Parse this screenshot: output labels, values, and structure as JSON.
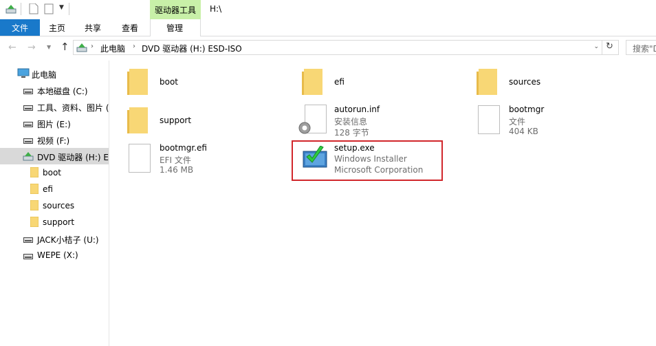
{
  "titlebar": {
    "context_tab": "驱动器工具",
    "window_title": "H:\\"
  },
  "ribbon": {
    "tabs": [
      "文件",
      "主页",
      "共享",
      "查看",
      "管理"
    ]
  },
  "address": {
    "breadcrumb": [
      "此电脑",
      "DVD 驱动器 (H:) ESD-ISO"
    ],
    "search_placeholder": "搜索\"D"
  },
  "nav": {
    "items": [
      {
        "label": "此电脑",
        "icon": "computer-icon"
      },
      {
        "label": "本地磁盘 (C:)",
        "icon": "drive-icon"
      },
      {
        "label": "工具、资料、图片 (",
        "icon": "drive-icon"
      },
      {
        "label": "图片 (E:)",
        "icon": "drive-icon"
      },
      {
        "label": "视频 (F:)",
        "icon": "drive-icon"
      },
      {
        "label": "DVD 驱动器 (H:) ES",
        "icon": "dvd-drive-icon",
        "selected": true
      },
      {
        "label": "boot",
        "icon": "folder-icon"
      },
      {
        "label": "efi",
        "icon": "folder-icon"
      },
      {
        "label": "sources",
        "icon": "folder-icon"
      },
      {
        "label": "support",
        "icon": "folder-icon"
      },
      {
        "label": "JACK小桔子 (U:)",
        "icon": "drive-icon"
      },
      {
        "label": "WEPE (X:)",
        "icon": "drive-icon"
      }
    ]
  },
  "files": [
    {
      "name": "boot",
      "type": "folder"
    },
    {
      "name": "efi",
      "type": "folder"
    },
    {
      "name": "sources",
      "type": "folder"
    },
    {
      "name": "support",
      "type": "folder"
    },
    {
      "name": "autorun.inf",
      "type": "settings-file",
      "line1": "安装信息",
      "line2": "128 字节"
    },
    {
      "name": "bootmgr",
      "type": "file",
      "line1": "文件",
      "line2": "404 KB"
    },
    {
      "name": "bootmgr.efi",
      "type": "file",
      "line1": "EFI 文件",
      "line2": "1.46 MB"
    },
    {
      "name": "setup.exe",
      "type": "installer",
      "line1": "Windows Installer",
      "line2": "Microsoft Corporation"
    }
  ],
  "colors": {
    "accent": "#1979ca",
    "context_tab": "#c8f0a8",
    "selection": "#d9d9d9",
    "highlight_border": "#d1262b",
    "folder": "#f8d775"
  }
}
